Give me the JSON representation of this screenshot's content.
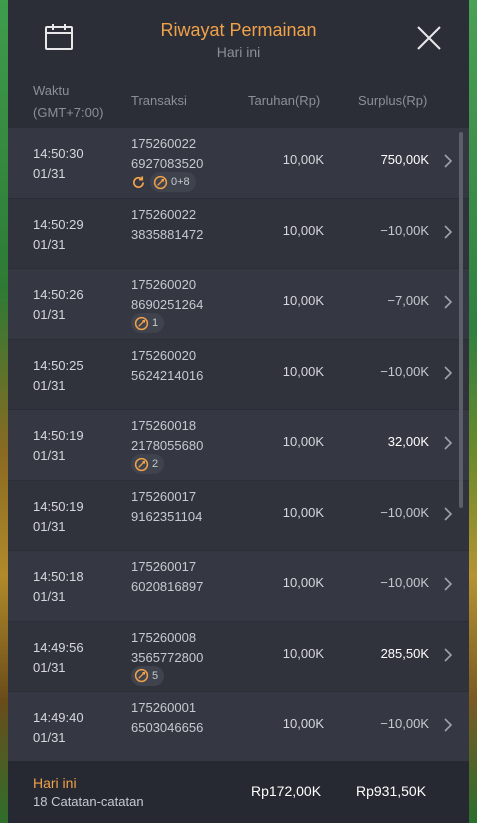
{
  "header": {
    "title": "Riwayat Permainan",
    "subtitle": "Hari ini",
    "calendar_icon": "calendar-icon",
    "close_icon": "close-icon"
  },
  "columns": {
    "waktu": "Waktu",
    "timezone": "(GMT+7:00)",
    "transaksi": "Transaksi",
    "taruhan": "Taruhan(Rp)",
    "surplus": "Surplus(Rp)"
  },
  "colors": {
    "accent": "#f0a14a",
    "panel": "#2b2e37"
  },
  "rows": [
    {
      "time": "14:50:30",
      "date": "01/31",
      "tx1": "175260022",
      "tx2": "6927083520",
      "bet": "10,00K",
      "surplus": "750,00K",
      "badge": "0+8",
      "badge_icons": [
        "respin-icon",
        "bonus-icon"
      ]
    },
    {
      "time": "14:50:29",
      "date": "01/31",
      "tx1": "175260022",
      "tx2": "3835881472",
      "bet": "10,00K",
      "surplus": "−10,00K"
    },
    {
      "time": "14:50:26",
      "date": "01/31",
      "tx1": "175260020",
      "tx2": "8690251264",
      "bet": "10,00K",
      "surplus": "−7,00K",
      "badge": "1",
      "badge_icons": [
        "bonus-icon"
      ]
    },
    {
      "time": "14:50:25",
      "date": "01/31",
      "tx1": "175260020",
      "tx2": "5624214016",
      "bet": "10,00K",
      "surplus": "−10,00K"
    },
    {
      "time": "14:50:19",
      "date": "01/31",
      "tx1": "175260018",
      "tx2": "2178055680",
      "bet": "10,00K",
      "surplus": "32,00K",
      "badge": "2",
      "badge_icons": [
        "bonus-icon"
      ]
    },
    {
      "time": "14:50:19",
      "date": "01/31",
      "tx1": "175260017",
      "tx2": "9162351104",
      "bet": "10,00K",
      "surplus": "−10,00K"
    },
    {
      "time": "14:50:18",
      "date": "01/31",
      "tx1": "175260017",
      "tx2": "6020816897",
      "bet": "10,00K",
      "surplus": "−10,00K"
    },
    {
      "time": "14:49:56",
      "date": "01/31",
      "tx1": "175260008",
      "tx2": "3565772800",
      "bet": "10,00K",
      "surplus": "285,50K",
      "badge": "5",
      "badge_icons": [
        "bonus-icon"
      ]
    },
    {
      "time": "14:49:40",
      "date": "01/31",
      "tx1": "175260001",
      "tx2": "6503046656",
      "bet": "10,00K",
      "surplus": "−10,00K"
    }
  ],
  "footer": {
    "label": "Hari ini",
    "count": "18 Catatan-catatan",
    "total_bet": "Rp172,00K",
    "total_surplus": "Rp931,50K"
  }
}
